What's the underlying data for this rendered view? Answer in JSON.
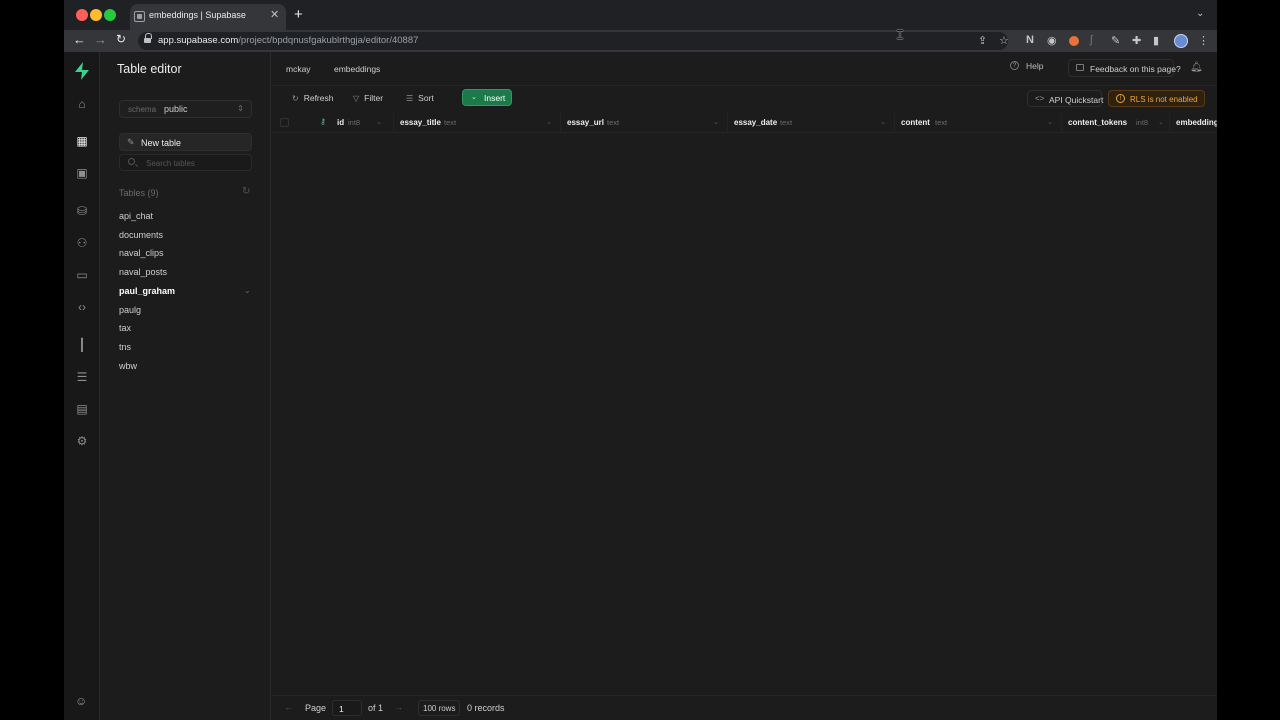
{
  "browser": {
    "tab_title": "embeddings | Supabase",
    "tab_close": "✕",
    "new_tab": "+",
    "tab_menu": "⌄",
    "url_host": "app.supabase.com",
    "url_path": "/project/bpdqnusfgakublrthgja/editor/40887"
  },
  "sidebar": {
    "title": "Table editor",
    "schema_label": "schema",
    "schema_value": "public",
    "new_table_label": "New table",
    "search_placeholder": "Search tables",
    "tables_header": "Tables (9)",
    "tables": [
      {
        "label": "api_chat",
        "selected": false
      },
      {
        "label": "documents",
        "selected": false
      },
      {
        "label": "naval_clips",
        "selected": false
      },
      {
        "label": "naval_posts",
        "selected": false
      },
      {
        "label": "paul_graham",
        "selected": true
      },
      {
        "label": "paulg",
        "selected": false
      },
      {
        "label": "tax",
        "selected": false
      },
      {
        "label": "tns",
        "selected": false
      },
      {
        "label": "wbw",
        "selected": false
      }
    ]
  },
  "topbar": {
    "breadcrumbs": [
      "mckay",
      "embeddings"
    ],
    "help_label": "Help",
    "feedback_label": "Feedback on this page?"
  },
  "gridbar": {
    "refresh_label": "Refresh",
    "filter_label": "Filter",
    "sort_label": "Sort",
    "insert_label": "Insert",
    "api_label": "API Quickstart",
    "rls_label": "RLS is not enabled"
  },
  "columns": [
    {
      "name": "id",
      "type": "int8",
      "primary_key": true
    },
    {
      "name": "essay_title",
      "type": "text"
    },
    {
      "name": "essay_url",
      "type": "text"
    },
    {
      "name": "essay_date",
      "type": "text"
    },
    {
      "name": "content",
      "type": "text"
    },
    {
      "name": "content_tokens",
      "type": "int8"
    },
    {
      "name": "embedding",
      "type": ""
    }
  ],
  "footer": {
    "page_label": "Page",
    "page_value": "1",
    "of_label": "of 1",
    "rows_label": "100 rows",
    "records_label": "0 records"
  },
  "colors": {
    "accent_green": "#3ecf8e",
    "insert_bg": "#1a7a4a",
    "warning": "#f0a43a"
  }
}
